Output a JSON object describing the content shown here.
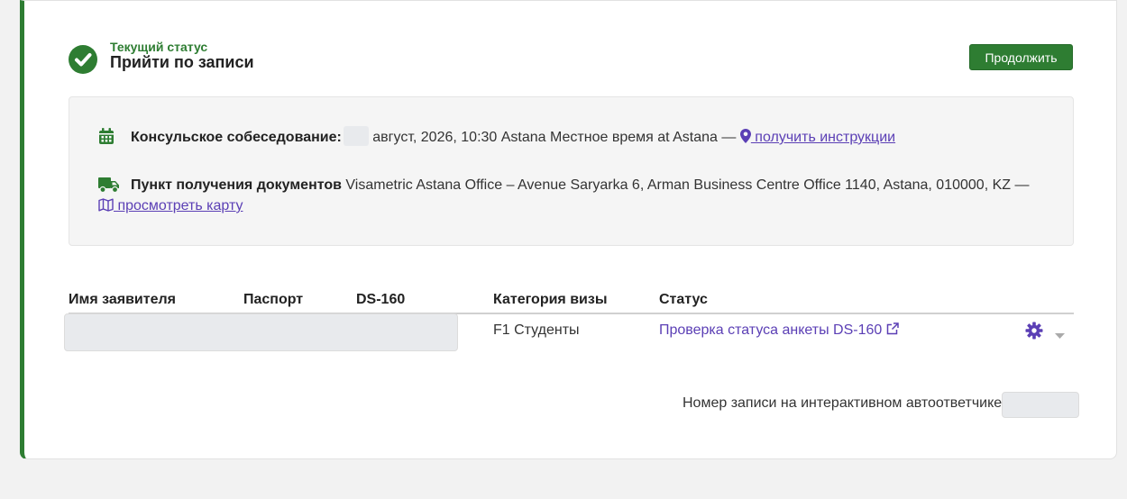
{
  "status": {
    "label": "Текущий статус",
    "title": "Прийти по записи",
    "continue_button": "Продолжить"
  },
  "appointment": {
    "consular_label": "Консульское собеседование:",
    "consular_text": "август, 2026, 10:30 Astana Местное время at Astana —",
    "consular_link": " получить инструкции",
    "pickup_label": "Пункт получения документов",
    "pickup_text": " Visametric Astana Office – Avenue Saryarka 6, Arman Business Centre Office 1140, Astana, 010000, KZ —",
    "pickup_link": " просмотреть карту"
  },
  "table": {
    "headers": {
      "applicant": "Имя заявителя",
      "passport": "Паспорт",
      "ds160": "DS-160",
      "visa_category": "Категория визы",
      "status": "Статус"
    },
    "rows": [
      {
        "visa_category": "F1 Студенты",
        "status_link": "Проверка статуса анкеты DS-160"
      }
    ]
  },
  "ivr": {
    "label": "Номер записи на интерактивном автоответчике"
  },
  "colors": {
    "accent_green": "#2e7d32",
    "link_purple": "#5b3fb5"
  },
  "icons": {
    "status": "check-circle-icon",
    "calendar": "calendar-icon",
    "truck": "truck-icon",
    "pin": "map-pin-icon",
    "map": "map-icon",
    "external": "external-link-icon",
    "gear": "gear-icon",
    "caret": "caret-down-icon"
  }
}
